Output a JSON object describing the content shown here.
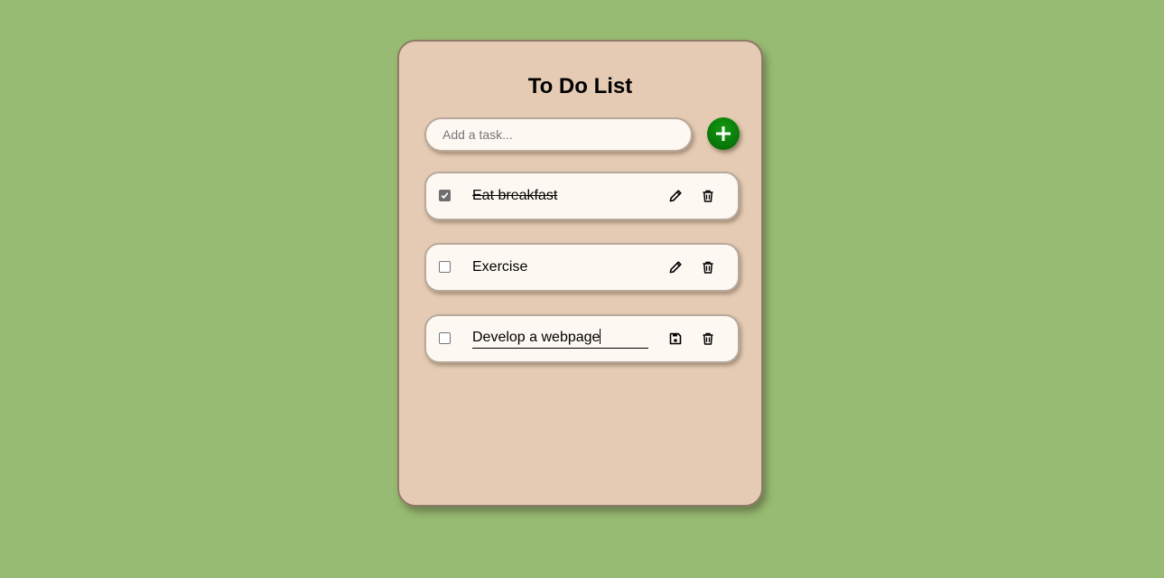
{
  "app": {
    "title": "To Do List"
  },
  "input": {
    "placeholder": "Add a task...",
    "value": ""
  },
  "add_button": {
    "icon": "plus-icon"
  },
  "tasks": [
    {
      "text": "Eat breakfast",
      "completed": true,
      "editing": false
    },
    {
      "text": "Exercise",
      "completed": false,
      "editing": false
    },
    {
      "text": "Develop a webpage",
      "completed": false,
      "editing": true
    }
  ],
  "colors": {
    "background": "#97bb72",
    "card": "#e5cbb3",
    "item": "#fdf8f2",
    "accent": "#0a7d0a"
  }
}
